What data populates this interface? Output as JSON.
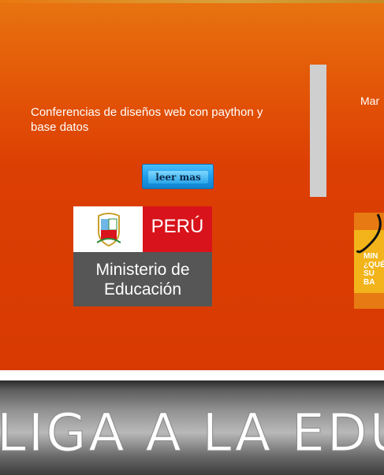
{
  "hero": {
    "conference_text": "Conferencias de diseños web con paython y base datos",
    "more_button": "leer mas",
    "side_text": "Mar"
  },
  "minedu_logo": {
    "country": "PERÚ",
    "ministry_line1": "Ministerio de",
    "ministry_line2": "Educación"
  },
  "promo": {
    "line1": "MIN",
    "line2": "¿QUÉ",
    "line3": "SU BA"
  },
  "banner": {
    "text": "LIGA A LA EDU"
  },
  "colors": {
    "hero_top": "#e87410",
    "hero_bottom": "#d83a02",
    "button": "#1c9be6",
    "peru_red": "#d8131b",
    "ministry_gray": "#565656"
  }
}
